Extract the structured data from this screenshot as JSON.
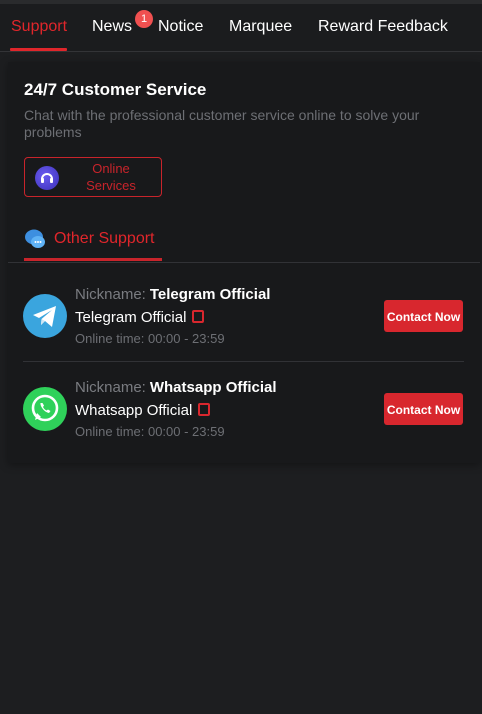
{
  "tabs": [
    {
      "label": "Support",
      "active": true
    },
    {
      "label": "News",
      "badge": "1"
    },
    {
      "label": "Notice"
    },
    {
      "label": "Marquee"
    },
    {
      "label": "Reward Feedback"
    }
  ],
  "customer_service": {
    "title": "24/7 Customer Service",
    "description": "Chat with the professional customer service online to solve your problems",
    "online_button": "Online Services"
  },
  "other_support": {
    "heading": "Other Support",
    "contacts": [
      {
        "nickname_label": "Nickname:",
        "nickname": "Telegram Official",
        "name": "Telegram Official",
        "online_time": "Online time: 00:00 - 23:59",
        "button": "Contact Now",
        "icon": "telegram-icon"
      },
      {
        "nickname_label": "Nickname:",
        "nickname": "Whatsapp Official",
        "name": "Whatsapp Official",
        "online_time": "Online time: 00:00 - 23:59",
        "button": "Contact Now",
        "icon": "whatsapp-icon"
      }
    ]
  },
  "colors": {
    "accent": "#e0262b",
    "background": "#1d1e20",
    "panel": "#18191b",
    "muted_text": "#6d6f74"
  }
}
